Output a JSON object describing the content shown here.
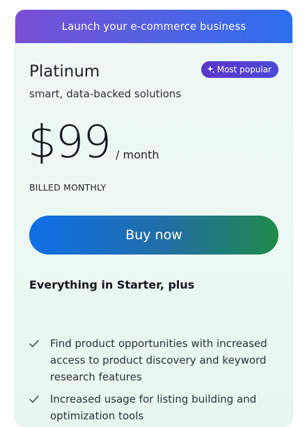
{
  "banner": {
    "text": "Launch your e-commerce business"
  },
  "plan": {
    "name": "Platinum",
    "badge": "Most popular",
    "badge_icon": "sparkle-icon",
    "subtitle": "smart, data-backed solutions",
    "price": "$99",
    "period": "/ month",
    "billing": "BILLED MONTHLY",
    "cta": "Buy now"
  },
  "features": {
    "title": "Everything in Starter, plus",
    "items": [
      {
        "icon": "check-icon",
        "text": "Find product opportunities with increased access to product discovery and keyword research features"
      },
      {
        "icon": "check-icon",
        "text": "Increased usage for listing building and optimization tools"
      }
    ]
  },
  "colors": {
    "banner_start": "#7a4ed3",
    "banner_end": "#2d6ff0",
    "button_start": "#0f6fe8",
    "button_end": "#1f8a4a",
    "badge": "#5b36c9",
    "card_bg": "#eef8f5"
  }
}
